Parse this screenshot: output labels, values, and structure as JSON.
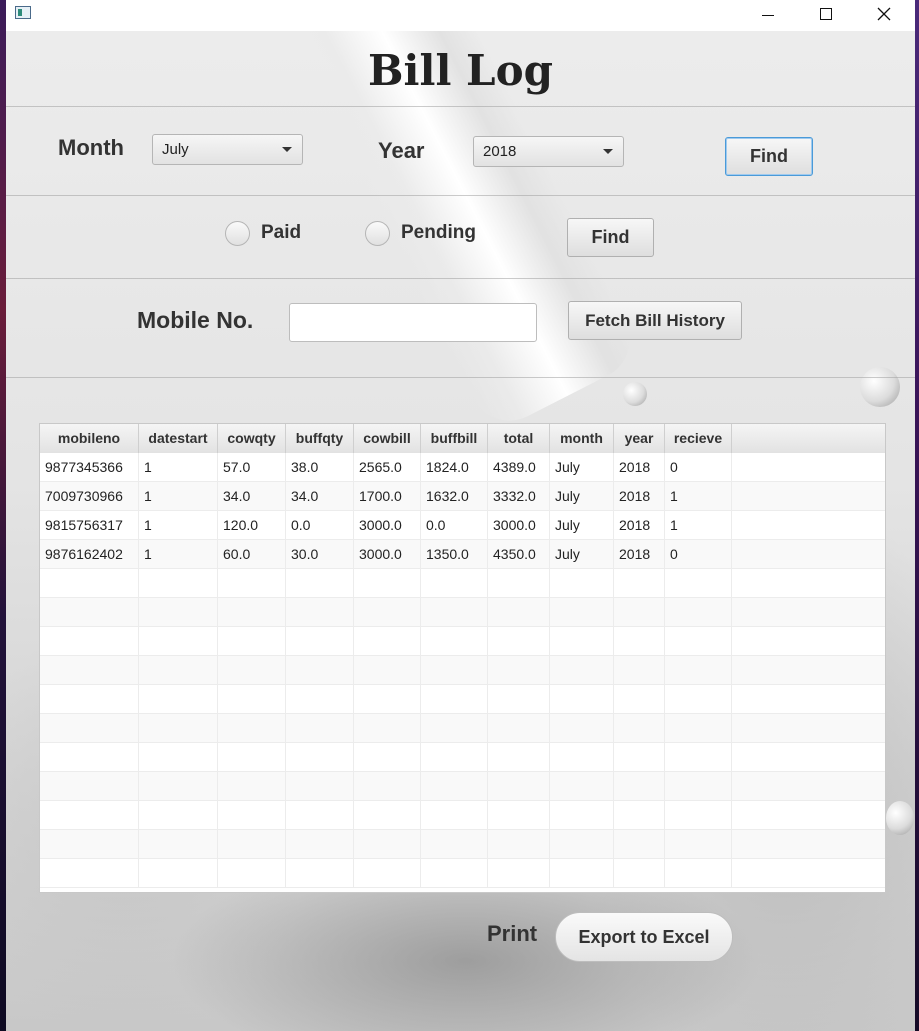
{
  "window": {
    "title": ""
  },
  "page": {
    "title": "Bill Log"
  },
  "filters": {
    "month_label": "Month",
    "month_value": "July",
    "year_label": "Year",
    "year_value": "2018",
    "find_label": "Find"
  },
  "status": {
    "paid_label": "Paid",
    "pending_label": "Pending",
    "find_label": "Find"
  },
  "mobile": {
    "label": "Mobile No.",
    "value": "",
    "fetch_label": "Fetch Bill History"
  },
  "table": {
    "columns": [
      "mobileno",
      "datestart",
      "cowqty",
      "buffqty",
      "cowbill",
      "buffbill",
      "total",
      "month",
      "year",
      "recieve"
    ],
    "rows": [
      [
        "9877345366",
        "1",
        "57.0",
        "38.0",
        "2565.0",
        "1824.0",
        "4389.0",
        "July",
        "2018",
        "0"
      ],
      [
        "7009730966",
        "1",
        "34.0",
        "34.0",
        "1700.0",
        "1632.0",
        "3332.0",
        "July",
        "2018",
        "1"
      ],
      [
        "9815756317",
        "1",
        "120.0",
        "0.0",
        "3000.0",
        "0.0",
        "3000.0",
        "July",
        "2018",
        "1"
      ],
      [
        "9876162402",
        "1",
        "60.0",
        "30.0",
        "3000.0",
        "1350.0",
        "4350.0",
        "July",
        "2018",
        "0"
      ]
    ]
  },
  "footer": {
    "print_label": "Print",
    "export_label": "Export to Excel"
  },
  "icons": {
    "app": "app-window-icon",
    "minimize": "minimize-icon",
    "maximize": "maximize-icon",
    "close": "close-icon",
    "dropdown": "chevron-down-icon"
  }
}
